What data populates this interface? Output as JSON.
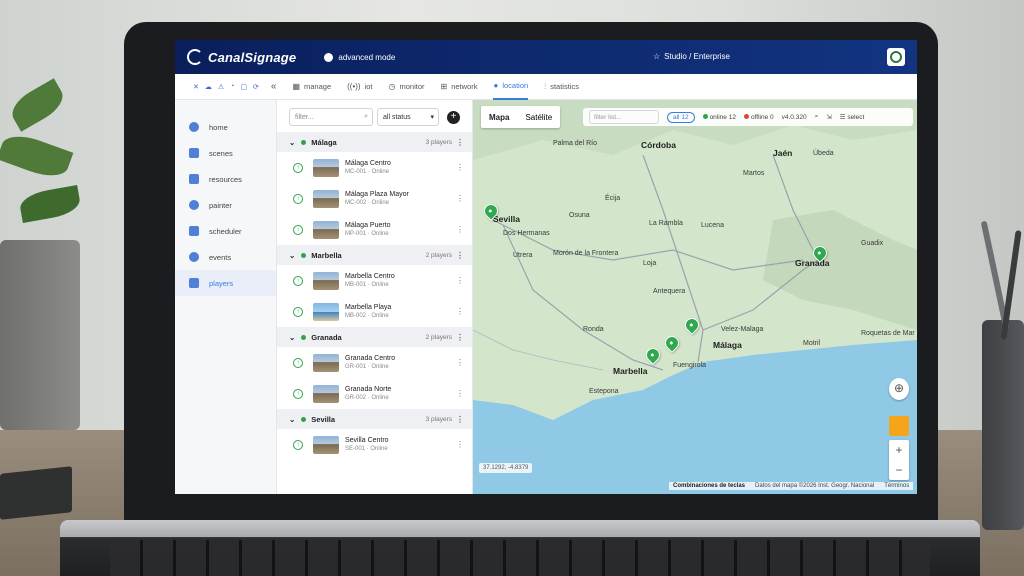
{
  "header": {
    "brand": "CanalSignage",
    "mode": "advanced mode",
    "plan": "Studio / Enterprise"
  },
  "nav": {
    "tabs": [
      {
        "label": "manage",
        "icon": "grid-icon"
      },
      {
        "label": "iot",
        "icon": "signal-icon"
      },
      {
        "label": "monitor",
        "icon": "gauge-icon"
      },
      {
        "label": "network",
        "icon": "network-icon"
      },
      {
        "label": "location",
        "icon": "pin-icon"
      },
      {
        "label": "statistics",
        "icon": "bars-icon"
      }
    ],
    "active": "location"
  },
  "sidebar": {
    "items": [
      {
        "label": "home"
      },
      {
        "label": "scenes"
      },
      {
        "label": "resources"
      },
      {
        "label": "painter"
      },
      {
        "label": "scheduler"
      },
      {
        "label": "events"
      },
      {
        "label": "players"
      }
    ]
  },
  "filters": {
    "placeholder": "filter...",
    "status": "all status"
  },
  "groups": [
    {
      "name": "Málaga",
      "count": "3 players",
      "players": [
        {
          "name": "Málaga Centro",
          "sub": "MC-001 · Online"
        },
        {
          "name": "Málaga Plaza Mayor",
          "sub": "MC-002 · Online"
        },
        {
          "name": "Málaga Puerto",
          "sub": "MP-001 · Online"
        }
      ]
    },
    {
      "name": "Marbella",
      "count": "2 players",
      "players": [
        {
          "name": "Marbella Centro",
          "sub": "MB-001 · Online"
        },
        {
          "name": "Marbella Playa",
          "sub": "MB-002 · Online"
        }
      ]
    },
    {
      "name": "Granada",
      "count": "2 players",
      "players": [
        {
          "name": "Granada Centro",
          "sub": "GR-001 · Online"
        },
        {
          "name": "Granada Norte",
          "sub": "GR-002 · Online"
        }
      ]
    },
    {
      "name": "Sevilla",
      "count": "3 players",
      "players": [
        {
          "name": "Sevilla Centro",
          "sub": "SE-001 · Online"
        }
      ]
    }
  ],
  "map": {
    "type_map": "Mapa",
    "type_sat": "Satélite",
    "filter_placeholder": "filter list...",
    "all": "all",
    "all_count": "12",
    "online": "online",
    "online_count": "12",
    "offline": "offline",
    "offline_count": "0",
    "version": "v4.0.320",
    "select": "select",
    "coords": "37.1292, -4.8379",
    "shortcuts": "Combinaciones de teclas",
    "data": "Datos del mapa ©2026 Inst. Geogr. Nacional",
    "terms": "Términos",
    "cities": {
      "sevilla": "Sevilla",
      "cordoba": "Córdoba",
      "jaen": "Jaén",
      "granada": "Granada",
      "malaga": "Málaga",
      "marbella": "Marbella",
      "fuengirola": "Fuengirola",
      "dos_hermanas": "Dos Hermanas",
      "utrera": "Utrera",
      "moron": "Morón de la Frontera",
      "ecija": "Écija",
      "lucena": "Lucena",
      "la_rambla": "La Rambla",
      "loja": "Loja",
      "antequera": "Antequera",
      "ronda": "Ronda",
      "estepona": "Estepona",
      "velez": "Velez-Malaga",
      "roquetas": "Roquetas de Mar",
      "guadix": "Guadix",
      "ubeda": "Úbeda",
      "martos": "Martos",
      "palma": "Palma del Río",
      "osuna": "Osuna",
      "motril": "Motril"
    }
  },
  "colors": {
    "header": "#0a1f5c",
    "accent": "#3b7be0",
    "online": "#2ea44f",
    "offline": "#e0433b",
    "pin": "#2fa84f",
    "sea": "#8fc9e6"
  }
}
